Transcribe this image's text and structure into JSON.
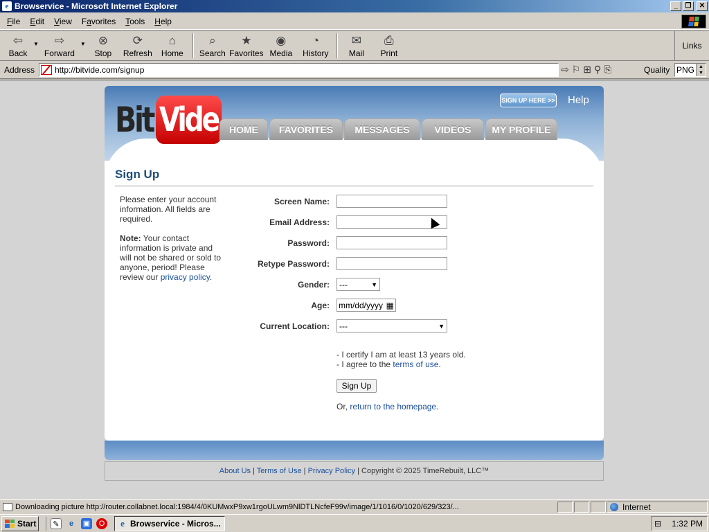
{
  "window": {
    "title": "Browservice - Microsoft Internet Explorer",
    "buttons": [
      "_",
      "❐",
      "✕"
    ]
  },
  "menu": [
    {
      "label": "File",
      "accel": "F",
      "rest": "ile"
    },
    {
      "label": "Edit",
      "accel": "E",
      "rest": "dit"
    },
    {
      "label": "View",
      "accel": "V",
      "rest": "iew"
    },
    {
      "label": "Favorites",
      "accel": "a",
      "pre": "F",
      "rest": "vorites"
    },
    {
      "label": "Tools",
      "accel": "T",
      "rest": "ools"
    },
    {
      "label": "Help",
      "accel": "H",
      "rest": "elp"
    }
  ],
  "toolbar": {
    "back": "Back",
    "forward": "Forward",
    "stop": "Stop",
    "refresh": "Refresh",
    "home": "Home",
    "search": "Search",
    "favorites": "Favorites",
    "media": "Media",
    "history": "History",
    "mail": "Mail",
    "print": "Print",
    "links": "Links"
  },
  "address": {
    "label": "Address",
    "url": "http://bitvide.com/signup",
    "quality_label": "Quality",
    "quality_value": "PNG"
  },
  "site": {
    "logo_left": "Bit",
    "logo_right": "Vide",
    "signup_here": "SIGN UP HERE >>",
    "help": "Help",
    "nav": [
      "HOME",
      "FAVORITES",
      "MESSAGES",
      "VIDEOS",
      "MY PROFILE"
    ],
    "page_title": "Sign Up",
    "intro": "Please enter your account information. All fields are required.",
    "note_label": "Note:",
    "note_text": " Your contact information is private and will not be shared or sold to anyone, period! Please review our ",
    "privacy_link": "privacy policy",
    "note_end": ".",
    "fields": {
      "screen_name": "Screen Name:",
      "email": "Email Address:",
      "password": "Password:",
      "retype_password": "Retype Password:",
      "gender": "Gender:",
      "age": "Age:",
      "location": "Current Location:"
    },
    "gender_value": "---",
    "age_placeholder": "mm/dd/yyyy",
    "location_value": "---",
    "cert_line1": "- I certify I am at least 13 years old.",
    "cert_line2_pre": "- I agree to the ",
    "terms_link": "terms of use",
    "cert_line2_end": ".",
    "signup_button": "Sign Up",
    "or_text": "Or, ",
    "return_link": "return to the homepage",
    "or_end": ".",
    "footer": {
      "about": "About Us",
      "terms": "Terms of Use",
      "privacy": "Privacy Policy",
      "sep": " | ",
      "copyright": " | Copyright © 2025 TimeRebuilt, LLC™"
    }
  },
  "status": {
    "text": "Downloading picture http://router.collabnet.local:1984/4/0KUMwxP9xw1rgoULwm9NlDTLNcfeF99v/image/1/1016/0/1020/629/323/...",
    "zone": "Internet"
  },
  "taskbar": {
    "start": "Start",
    "task": "Browservice - Micros...",
    "clock": "1:32 PM"
  }
}
